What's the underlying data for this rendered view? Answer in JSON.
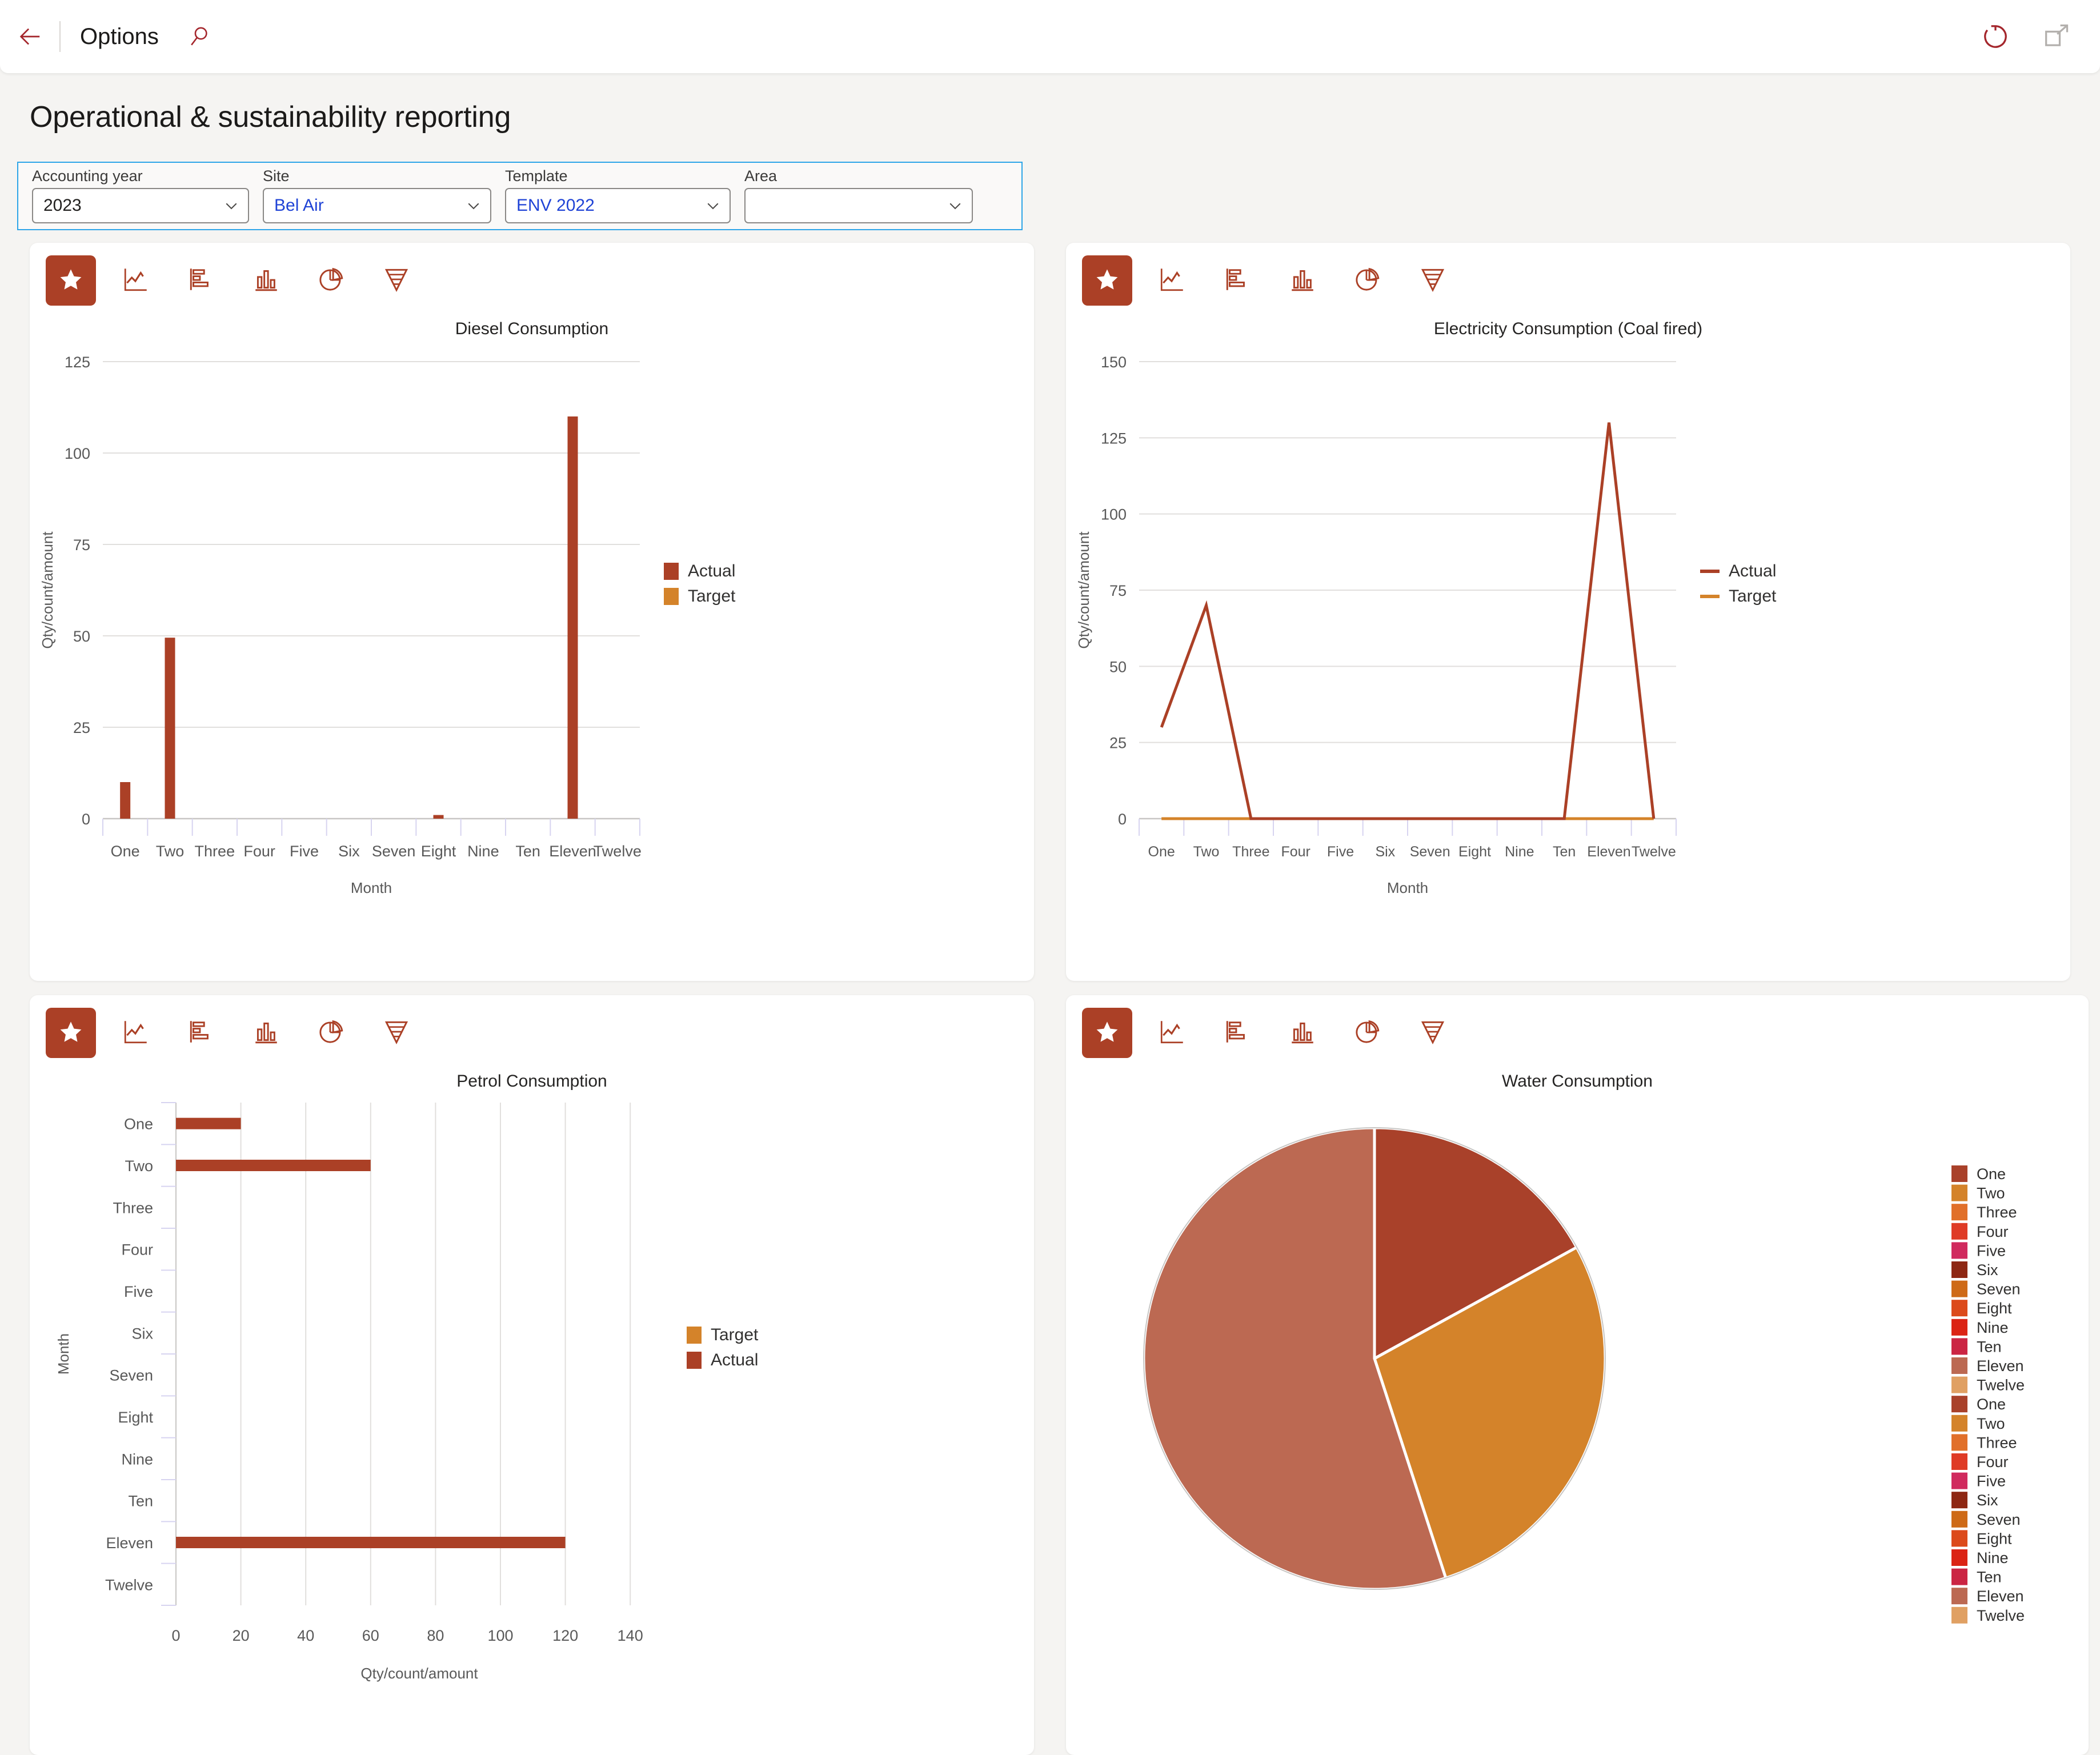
{
  "topbar": {
    "back_icon": "back-arrow-icon",
    "title": "Options",
    "search_icon": "search-icon",
    "refresh_icon": "refresh-icon",
    "popout_icon": "open-in-new-window-icon"
  },
  "page": {
    "title": "Operational & sustainability reporting"
  },
  "filters": [
    {
      "label": "Accounting year",
      "value": "2023",
      "linked": false,
      "width_class": "w-year",
      "name": "accounting-year"
    },
    {
      "label": "Site",
      "value": "Bel Air",
      "linked": true,
      "width_class": "w-site",
      "name": "site"
    },
    {
      "label": "Template",
      "value": "ENV 2022",
      "linked": true,
      "width_class": "w-tpl",
      "name": "template"
    },
    {
      "label": "Area",
      "value": "",
      "linked": false,
      "width_class": "w-area",
      "name": "area"
    }
  ],
  "tile_toolbar": {
    "favorite": "star-icon",
    "buttons": [
      {
        "icon": "line-chart-icon",
        "name": "chart-type-line"
      },
      {
        "icon": "bar-chart-icon",
        "name": "chart-type-bar"
      },
      {
        "icon": "column-chart-icon",
        "name": "chart-type-column"
      },
      {
        "icon": "pie-chart-icon",
        "name": "chart-type-pie"
      },
      {
        "icon": "funnel-icon",
        "name": "chart-type-funnel"
      }
    ]
  },
  "colors": {
    "actual": "#AB4026",
    "target": "#D4832A",
    "accent": "#AB4026",
    "focus_border": "#2EA5E8",
    "link": "#1F43D6",
    "grid": "#E1DFDD",
    "page_bg": "#F5F4F2"
  },
  "chart_data": [
    {
      "id": "diesel",
      "type": "bar",
      "title": "Diesel Consumption",
      "xlabel": "Month",
      "ylabel": "Qty/count/amount",
      "categories": [
        "One",
        "Two",
        "Three",
        "Four",
        "Five",
        "Six",
        "Seven",
        "Eight",
        "Nine",
        "Ten",
        "Eleven",
        "Twelve"
      ],
      "yticks": [
        0,
        25,
        50,
        75,
        100,
        125
      ],
      "ylim": [
        0,
        125
      ],
      "grid": true,
      "legend_position": "right",
      "series": [
        {
          "name": "Actual",
          "color": "#AB4026",
          "values": [
            10,
            49.5,
            0,
            0,
            0,
            0,
            0,
            1,
            0,
            0,
            110,
            0
          ]
        },
        {
          "name": "Target",
          "color": "#D4832A",
          "values": [
            0,
            0,
            0,
            0,
            0,
            0,
            0,
            0,
            0,
            0,
            0,
            0
          ]
        }
      ]
    },
    {
      "id": "electricity",
      "type": "line",
      "title": "Electricity Consumption (Coal fired)",
      "xlabel": "Month",
      "ylabel": "Qty/count/amount",
      "categories": [
        "One",
        "Two",
        "Three",
        "Four",
        "Five",
        "Six",
        "Seven",
        "Eight",
        "Nine",
        "Ten",
        "Eleven",
        "Twelve"
      ],
      "yticks": [
        0,
        25,
        50,
        75,
        100,
        125,
        150
      ],
      "ylim": [
        0,
        150
      ],
      "grid": true,
      "legend_position": "right",
      "series": [
        {
          "name": "Actual",
          "color": "#AB4026",
          "values": [
            30,
            70,
            0,
            0,
            0,
            0,
            0,
            0,
            0,
            0,
            130,
            0
          ]
        },
        {
          "name": "Target",
          "color": "#D4832A",
          "values": [
            0,
            0,
            0,
            0,
            0,
            0,
            0,
            0,
            0,
            0,
            0,
            0
          ]
        }
      ]
    },
    {
      "id": "petrol",
      "type": "barh",
      "title": "Petrol Consumption",
      "xlabel": "Qty/count/amount",
      "ylabel": "Month",
      "categories": [
        "One",
        "Two",
        "Three",
        "Four",
        "Five",
        "Six",
        "Seven",
        "Eight",
        "Nine",
        "Ten",
        "Eleven",
        "Twelve"
      ],
      "xticks": [
        0,
        20,
        40,
        60,
        80,
        100,
        120,
        140
      ],
      "xlim": [
        0,
        150
      ],
      "grid": true,
      "legend_position": "right",
      "series": [
        {
          "name": "Target",
          "color": "#D4832A",
          "values": [
            0,
            0,
            0,
            0,
            0,
            0,
            0,
            0,
            0,
            0,
            0,
            0
          ]
        },
        {
          "name": "Actual",
          "color": "#AB4026",
          "values": [
            20,
            60,
            0,
            0,
            0,
            0,
            0,
            0,
            0,
            0,
            120,
            0
          ]
        }
      ]
    },
    {
      "id": "water",
      "type": "pie",
      "title": "Water Consumption",
      "legend_position": "right",
      "slices": [
        {
          "label": "One",
          "value": 17,
          "color": "#A9412A"
        },
        {
          "label": "Two",
          "value": 28,
          "color": "#D4832A"
        },
        {
          "label": "Eleven",
          "value": 55,
          "color": "#BC6952"
        }
      ],
      "legend": [
        {
          "label": "One",
          "color": "#A9412A"
        },
        {
          "label": "Two",
          "color": "#D4832A"
        },
        {
          "label": "Three",
          "color": "#E1702A"
        },
        {
          "label": "Four",
          "color": "#DF3B26"
        },
        {
          "label": "Five",
          "color": "#D02A5E"
        },
        {
          "label": "Six",
          "color": "#8E2713"
        },
        {
          "label": "Seven",
          "color": "#CE6A17"
        },
        {
          "label": "Eight",
          "color": "#DC4A1B"
        },
        {
          "label": "Nine",
          "color": "#DB2314"
        },
        {
          "label": "Ten",
          "color": "#CB2543"
        },
        {
          "label": "Eleven",
          "color": "#BC6952"
        },
        {
          "label": "Twelve",
          "color": "#E0A063"
        },
        {
          "label": "One",
          "color": "#A9412A"
        },
        {
          "label": "Two",
          "color": "#D4832A"
        },
        {
          "label": "Three",
          "color": "#E1702A"
        },
        {
          "label": "Four",
          "color": "#DF3B26"
        },
        {
          "label": "Five",
          "color": "#D02A5E"
        },
        {
          "label": "Six",
          "color": "#8E2713"
        },
        {
          "label": "Seven",
          "color": "#CE6A17"
        },
        {
          "label": "Eight",
          "color": "#DC4A1B"
        },
        {
          "label": "Nine",
          "color": "#DB2314"
        },
        {
          "label": "Ten",
          "color": "#CB2543"
        },
        {
          "label": "Eleven",
          "color": "#BC6952"
        },
        {
          "label": "Twelve",
          "color": "#E0A063"
        }
      ]
    }
  ]
}
